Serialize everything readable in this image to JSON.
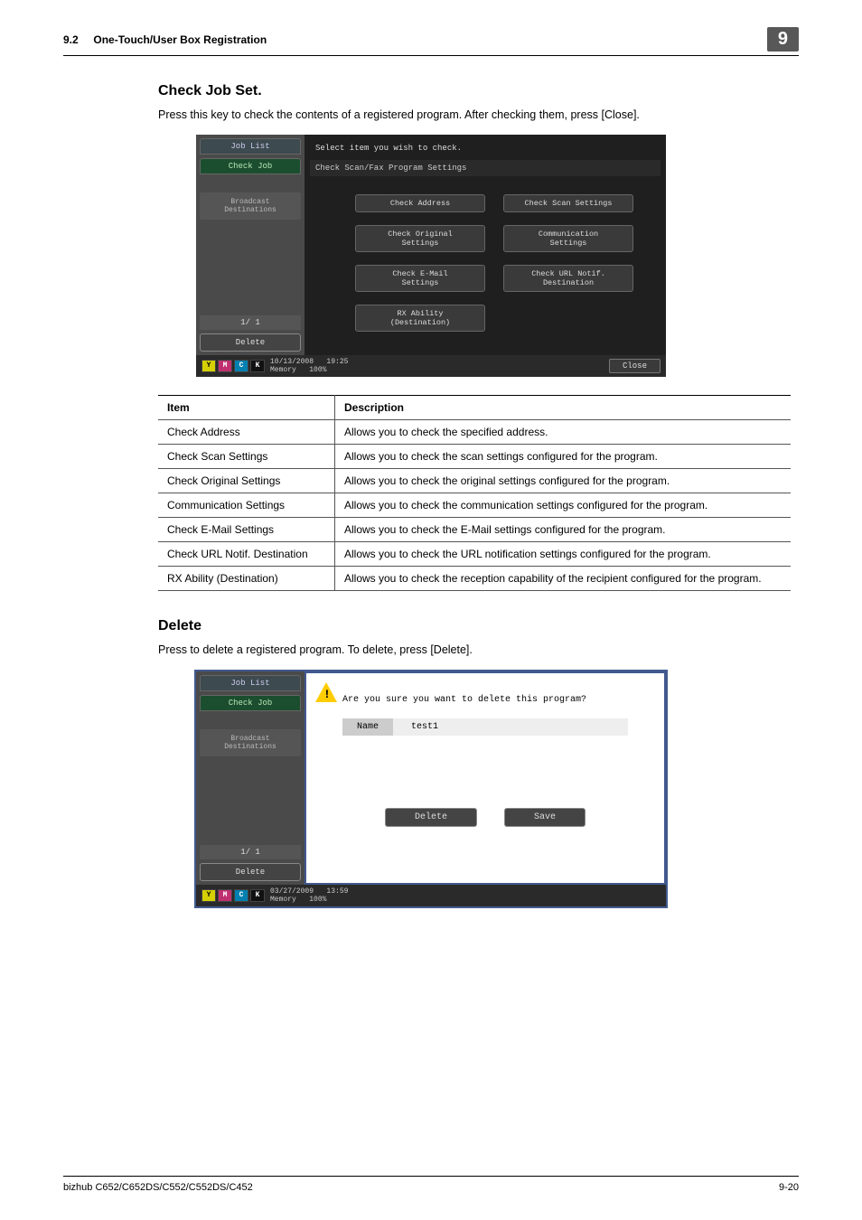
{
  "header": {
    "section_no": "9.2",
    "section_title": "One-Touch/User Box Registration",
    "chapter": "9"
  },
  "sec1": {
    "title": "Check Job Set.",
    "text": "Press this key to check the contents of a registered program. After checking them, press [Close]."
  },
  "shot1": {
    "tab_joblist": "Job List",
    "tab_checkjob": "Check Job",
    "side_label": "Broadcast\nDestinations",
    "pager": "1/  1",
    "delete": "Delete",
    "top_text": "Select item you wish to check.",
    "title_bar": "Check Scan/Fax Program Settings",
    "buttons": [
      "Check Address",
      "Check Scan Settings",
      "Check Original\nSettings",
      "Communication\nSettings",
      "Check E-Mail\nSettings",
      "Check URL Notif.\nDestination",
      "RX Ability\n(Destination)"
    ],
    "footer_date": "10/13/2008",
    "footer_time": "19:25",
    "footer_mem": "Memory",
    "footer_pct": "100%",
    "close": "Close"
  },
  "table": {
    "head_item": "Item",
    "head_desc": "Description",
    "rows": [
      {
        "item": "Check Address",
        "desc": "Allows you to check the specified address."
      },
      {
        "item": "Check Scan Settings",
        "desc": "Allows you to check the scan settings configured for the program."
      },
      {
        "item": "Check Original Settings",
        "desc": "Allows you to check the original settings configured for the program."
      },
      {
        "item": "Communication Settings",
        "desc": "Allows you to check the communication settings configured for the program."
      },
      {
        "item": "Check E-Mail Settings",
        "desc": "Allows you to check the E-Mail settings configured for the program."
      },
      {
        "item": "Check URL Notif. Destination",
        "desc": "Allows you to check the URL notification settings configured for the program."
      },
      {
        "item": "RX Ability (Destination)",
        "desc": "Allows you to check the reception capability of the recipient configured for the program."
      }
    ]
  },
  "sec2": {
    "title": "Delete",
    "text": "Press to delete a registered program. To delete, press [Delete]."
  },
  "shot2": {
    "tab_joblist": "Job List",
    "tab_checkjob": "Check Job",
    "side_label": "Broadcast\nDestinations",
    "pager": "1/  1",
    "delete": "Delete",
    "dlg_text": "Are you sure you want to delete this program?",
    "name_lbl": "Name",
    "name_val": "test1",
    "btn_delete": "Delete",
    "btn_save": "Save",
    "footer_date": "03/27/2009",
    "footer_time": "13:59",
    "footer_mem": "Memory",
    "footer_pct": "100%"
  },
  "footer": {
    "model": "bizhub C652/C652DS/C552/C552DS/C452",
    "page": "9-20"
  }
}
